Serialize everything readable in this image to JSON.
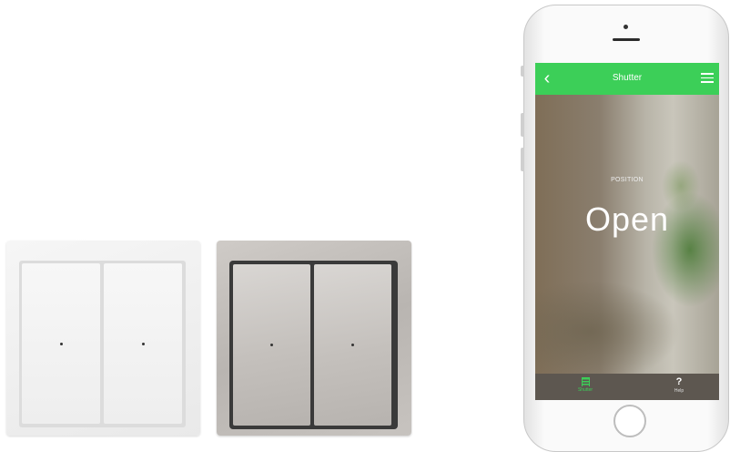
{
  "switches": [
    {
      "finish": "white"
    },
    {
      "finish": "silver"
    }
  ],
  "app": {
    "title": "Shutter",
    "back_icon": "‹",
    "menu_icon": "hamburger-menu",
    "position_label": "POSITION",
    "position_value": "Open",
    "accent_color": "#3ccf58",
    "tabs": [
      {
        "label": "Shutter",
        "icon": "shutter-icon",
        "active": true
      },
      {
        "label": "Help",
        "icon": "?",
        "active": false
      }
    ]
  }
}
